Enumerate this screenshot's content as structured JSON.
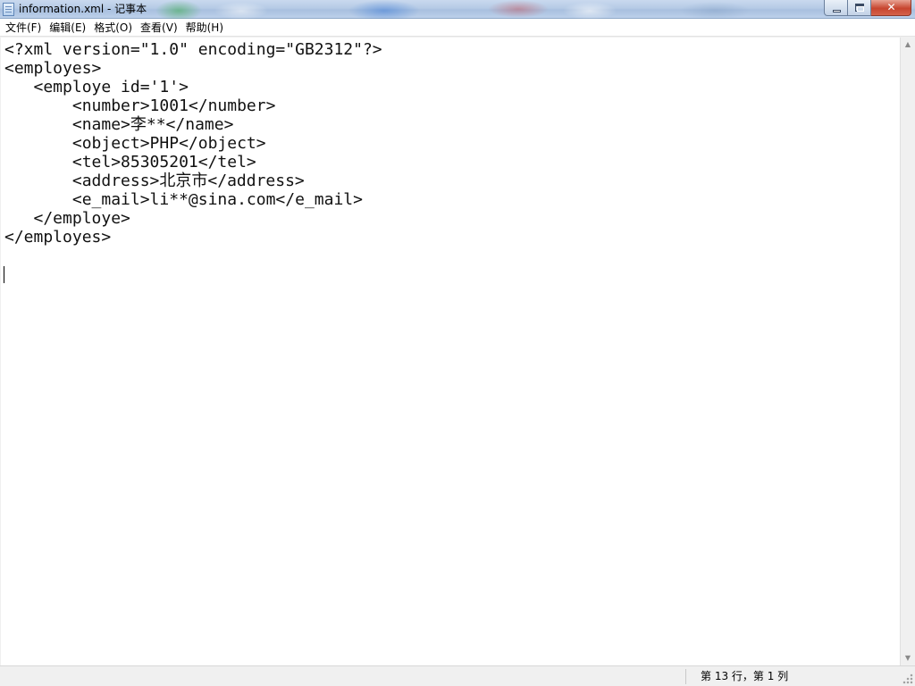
{
  "window": {
    "title": "information.xml - 记事本",
    "controls": {
      "close_glyph": "✕"
    }
  },
  "menu": {
    "items": [
      {
        "label": "文件(F)"
      },
      {
        "label": "编辑(E)"
      },
      {
        "label": "格式(O)"
      },
      {
        "label": "查看(V)"
      },
      {
        "label": "帮助(H)"
      }
    ]
  },
  "editor": {
    "content": "<?xml version=\"1.0\" encoding=\"GB2312\"?>\n<employes>\n   <employe id='1'>\n       <number>1001</number>\n       <name>李**</name>\n       <object>PHP</object>\n       <tel>85305201</tel>\n       <address>北京市</address>\n       <e_mail>li**@sina.com</e_mail>\n   </employe>\n</employes>"
  },
  "scrollbar": {
    "up_glyph": "▲",
    "down_glyph": "▼"
  },
  "status": {
    "position": "第 13 行，第 1 列"
  }
}
